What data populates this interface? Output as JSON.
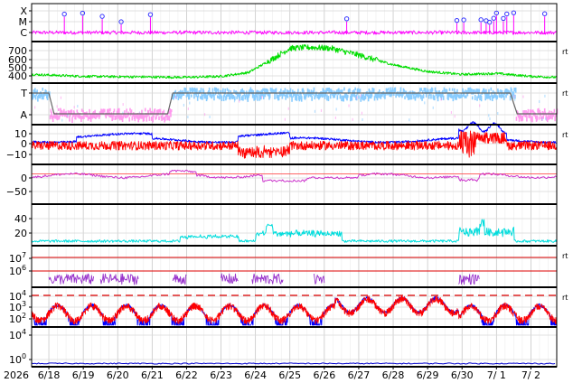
{
  "chart_data": {
    "type": "line",
    "year_label": "2026",
    "x_axis": {
      "start": "6/17 12:00",
      "end": "7/2 18:00",
      "tick_labels": [
        "6/18",
        "6/19",
        "6/20",
        "6/21",
        "6/22",
        "6/23",
        "6/24",
        "6/25",
        "6/26",
        "6/27",
        "6/28",
        "6/29",
        "6/30",
        "7/ 1",
        "7/ 2"
      ]
    },
    "panels": [
      {
        "id": "xray-class",
        "y_tick_labels": [
          "X",
          "M",
          "C"
        ],
        "color": "#ff00ff",
        "marker_color": "#3333ff",
        "flare_days": [
          18.45,
          18.98,
          19.55,
          20.1,
          20.95,
          26.65,
          29.85,
          30.05,
          30.55,
          30.7,
          30.8,
          30.92,
          31.0,
          31.2,
          31.3,
          31.5,
          32.4
        ]
      },
      {
        "id": "solar-wind-speed",
        "y_tick_labels": [
          "700",
          "600",
          "500",
          "400"
        ],
        "ylim": [
          330,
          760
        ],
        "color": "#00dd00",
        "side_tag": "rt",
        "profile_days": [
          17.5,
          19.0,
          20.5,
          22.0,
          23.0,
          23.8,
          24.4,
          25.0,
          25.6,
          26.2,
          27.0,
          28.0,
          29.0,
          30.0,
          31.0,
          32.0,
          32.75
        ],
        "profile_values": [
          420,
          400,
          395,
          390,
          400,
          440,
          560,
          690,
          700,
          690,
          620,
          520,
          450,
          420,
          430,
          400,
          390
        ]
      },
      {
        "id": "sector-polarity",
        "y_tick_labels": [
          "T",
          "A"
        ],
        "colors": [
          "#88ccff",
          "#ff99ee",
          "#666666"
        ],
        "side_tag": "rt"
      },
      {
        "id": "imf-components",
        "y_tick_labels": [
          "10",
          "0",
          "−10"
        ],
        "ylim": [
          -18,
          18
        ],
        "series_colors": [
          "#0000ff",
          "#ff0000"
        ],
        "side_tag": "rt"
      },
      {
        "id": "dst-index",
        "y_tick_labels": [
          "0",
          "−50"
        ],
        "ylim": [
          -80,
          25
        ],
        "color": "#cc33cc"
      },
      {
        "id": "kp-like",
        "y_tick_labels": [
          "40",
          "20"
        ],
        "ylim": [
          5,
          55
        ],
        "color": "#00dddd"
      },
      {
        "id": "proton-flux",
        "y_tick_labels": [
          "10",
          "10"
        ],
        "y_tick_exponents": [
          "7",
          "6"
        ],
        "color": "#9933cc",
        "threshold_color": "#dd0000",
        "side_tag": "rt"
      },
      {
        "id": "electron-flux",
        "y_tick_labels": [
          "10",
          "10",
          "10"
        ],
        "y_tick_exponents": [
          "4",
          "3",
          "2"
        ],
        "series_colors": [
          "#0000ff",
          "#ff0000"
        ],
        "threshold_color": "#dd0000",
        "side_tag": "rt"
      },
      {
        "id": "neutron-bottom",
        "y_tick_labels": [
          "10",
          "10"
        ],
        "y_tick_exponents": [
          "4",
          "0"
        ],
        "color": "#0000cc"
      }
    ]
  }
}
